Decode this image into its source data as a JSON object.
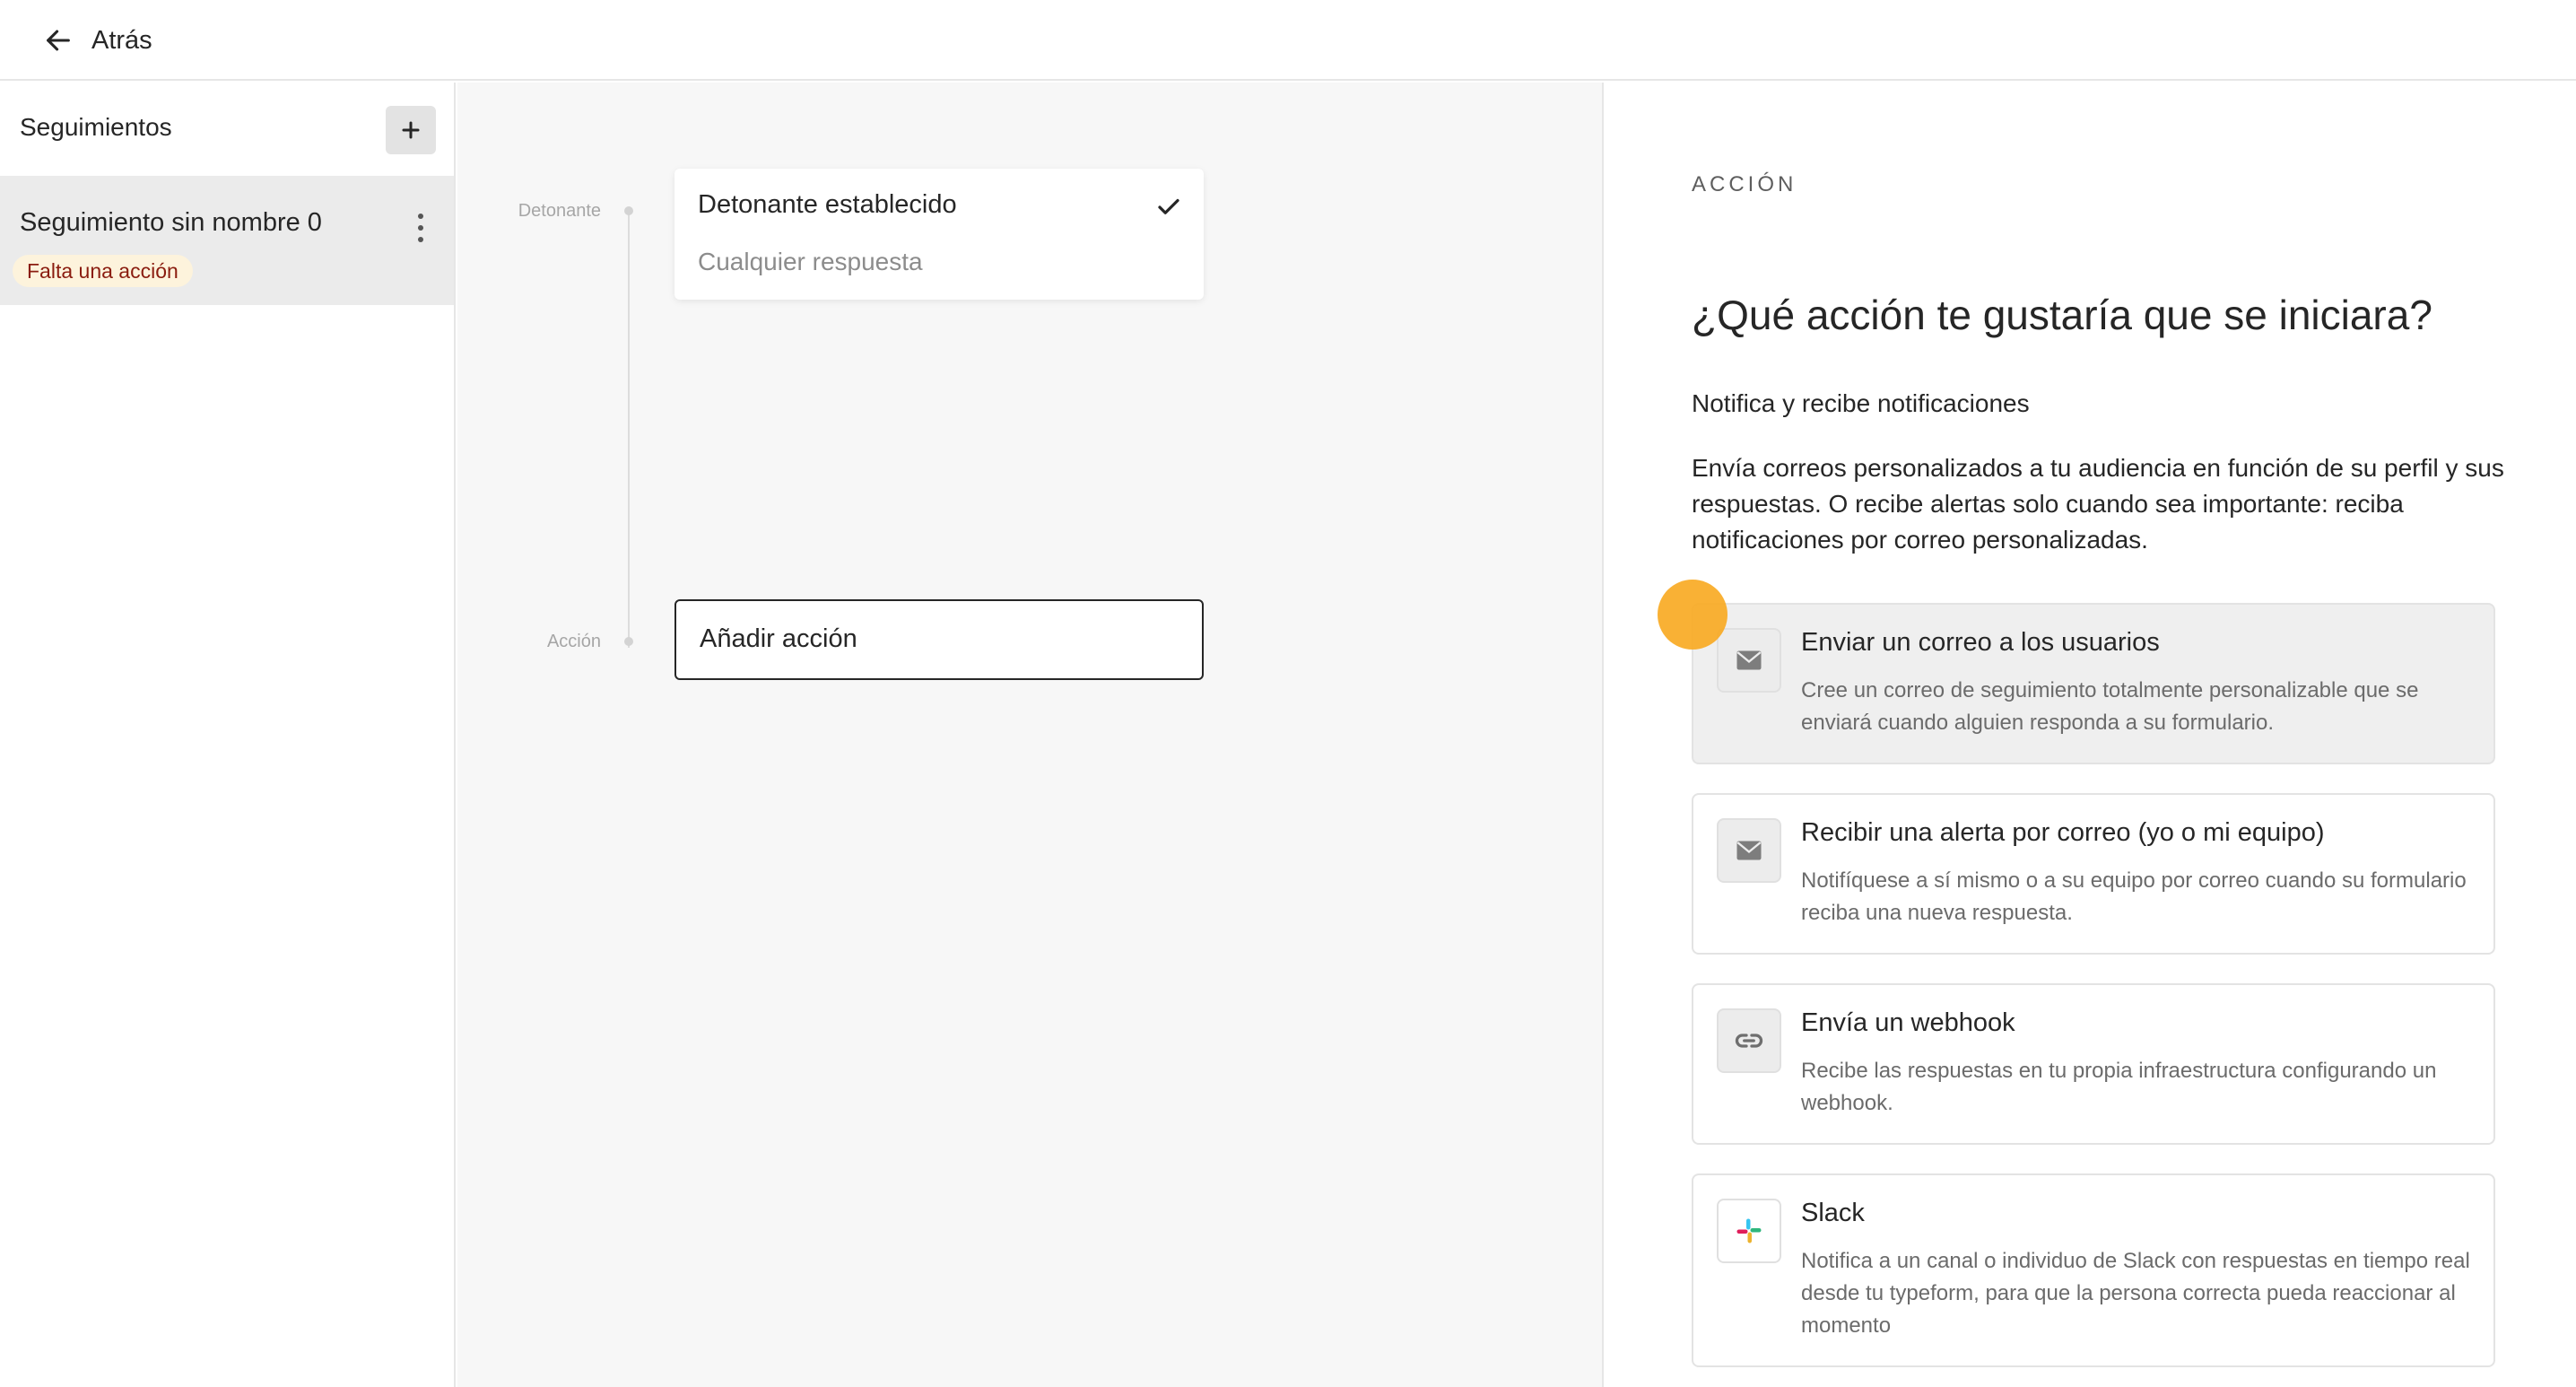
{
  "topbar": {
    "back_label": "Atrás"
  },
  "sidebar": {
    "title": "Seguimientos",
    "items": [
      {
        "name": "Seguimiento sin nombre 0",
        "badge": "Falta una acción"
      }
    ]
  },
  "canvas": {
    "trigger_step_label": "Detonante",
    "action_step_label": "Acción",
    "trigger": {
      "title": "Detonante establecido",
      "subtitle": "Cualquier respuesta"
    },
    "action": {
      "label": "Añadir acción"
    }
  },
  "panel": {
    "section_label": "ACCIÓN",
    "title": "¿Qué acción te gustaría que se iniciara?",
    "subtitle": "Notifica y recibe notificaciones",
    "description": "Envía correos personalizados a tu audiencia en función de su perfil y sus respuestas. O recibe alertas solo cuando sea importante: reciba notificaciones por correo personalizadas.",
    "options": [
      {
        "icon": "mail-icon",
        "title": "Enviar un correo a los usuarios",
        "description": "Cree un correo de seguimiento totalmente personalizable que se enviará cuando alguien responda a su formulario."
      },
      {
        "icon": "mail-icon",
        "title": "Recibir una alerta por correo (yo o mi equipo)",
        "description": "Notifíquese a sí mismo o a su equipo por correo cuando su formulario reciba una nueva respuesta."
      },
      {
        "icon": "link-icon",
        "title": "Envía un webhook",
        "description": "Recibe las respuestas en tu propia infraestructura configurando un webhook."
      },
      {
        "icon": "slack-icon",
        "title": "Slack",
        "description": "Notifica a un canal o individuo de Slack con respuestas en tiempo real desde tu typeform, para que la persona correcta pueda reaccionar al momento"
      }
    ]
  },
  "colors": {
    "badge_bg": "#fdf3dc",
    "badge_text": "#8a1c0f",
    "cursor_highlight": "#f8a91f",
    "selected_option_bg": "#efefef"
  }
}
